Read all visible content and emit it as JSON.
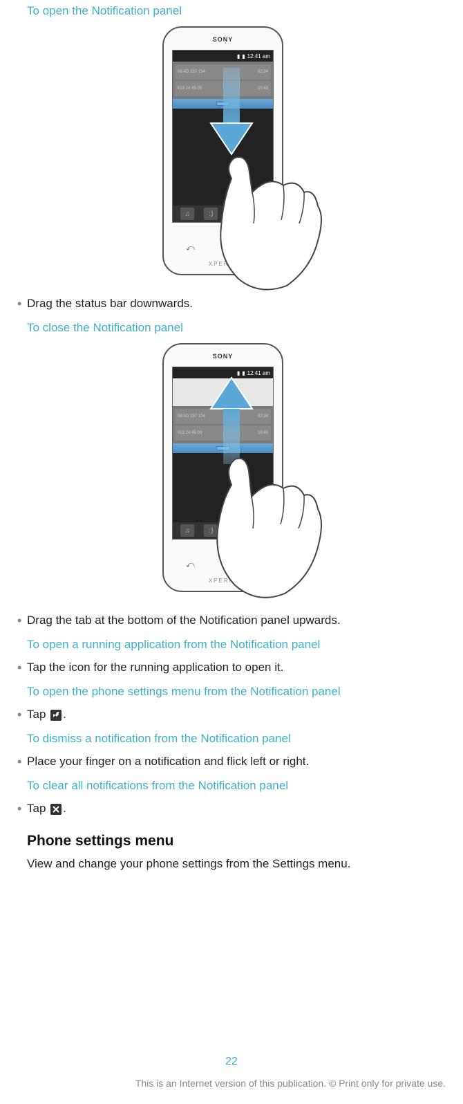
{
  "section1": {
    "title": "To open the Notification panel",
    "bullet": "Drag the status bar downwards."
  },
  "section2": {
    "title": "To close the Notification panel",
    "bullet": "Drag the tab at the bottom of the Notification panel upwards."
  },
  "section3": {
    "title": "To open a running application from the Notification panel",
    "bullet": "Tap the icon for the running application to open it."
  },
  "section4": {
    "title": "To open the phone settings menu from the Notification panel",
    "bullet_pre": "Tap ",
    "bullet_post": "."
  },
  "section5": {
    "title": "To dismiss a notification from the Notification panel",
    "bullet": "Place your finger on a notification and flick left or right."
  },
  "section6": {
    "title": "To clear all notifications from the Notification panel",
    "bullet_pre": "Tap ",
    "bullet_post": "."
  },
  "settings_heading": "Phone settings menu",
  "settings_body": "View and change your phone settings from the Settings menu.",
  "phone": {
    "brand": "SONY",
    "xperia": "XPERIA",
    "time": "12:41 am",
    "row1_left": "08 AD 237 134",
    "row1_right": "02:24",
    "row2_left": "013 24 45 00",
    "row2_right": "10:45"
  },
  "page_number": "22",
  "footer": "This is an Internet version of this publication. © Print only for private use."
}
